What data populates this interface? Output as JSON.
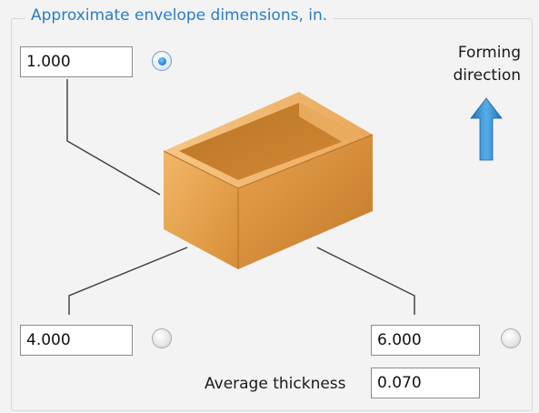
{
  "group": {
    "legend": "Approximate envelope dimensions, in."
  },
  "height": {
    "value": "1.000",
    "selected": true
  },
  "length": {
    "value": "4.000",
    "selected": false
  },
  "width": {
    "value": "6.000",
    "selected": false
  },
  "direction": {
    "line1": "Forming",
    "line2": "direction",
    "arrow_icon": "arrow-up-icon"
  },
  "thickness": {
    "label": "Average thickness",
    "value": "0.070"
  },
  "colors": {
    "accent": "#2a7cc7",
    "box": "#e7a24e",
    "arrow": "#2b86c8"
  }
}
